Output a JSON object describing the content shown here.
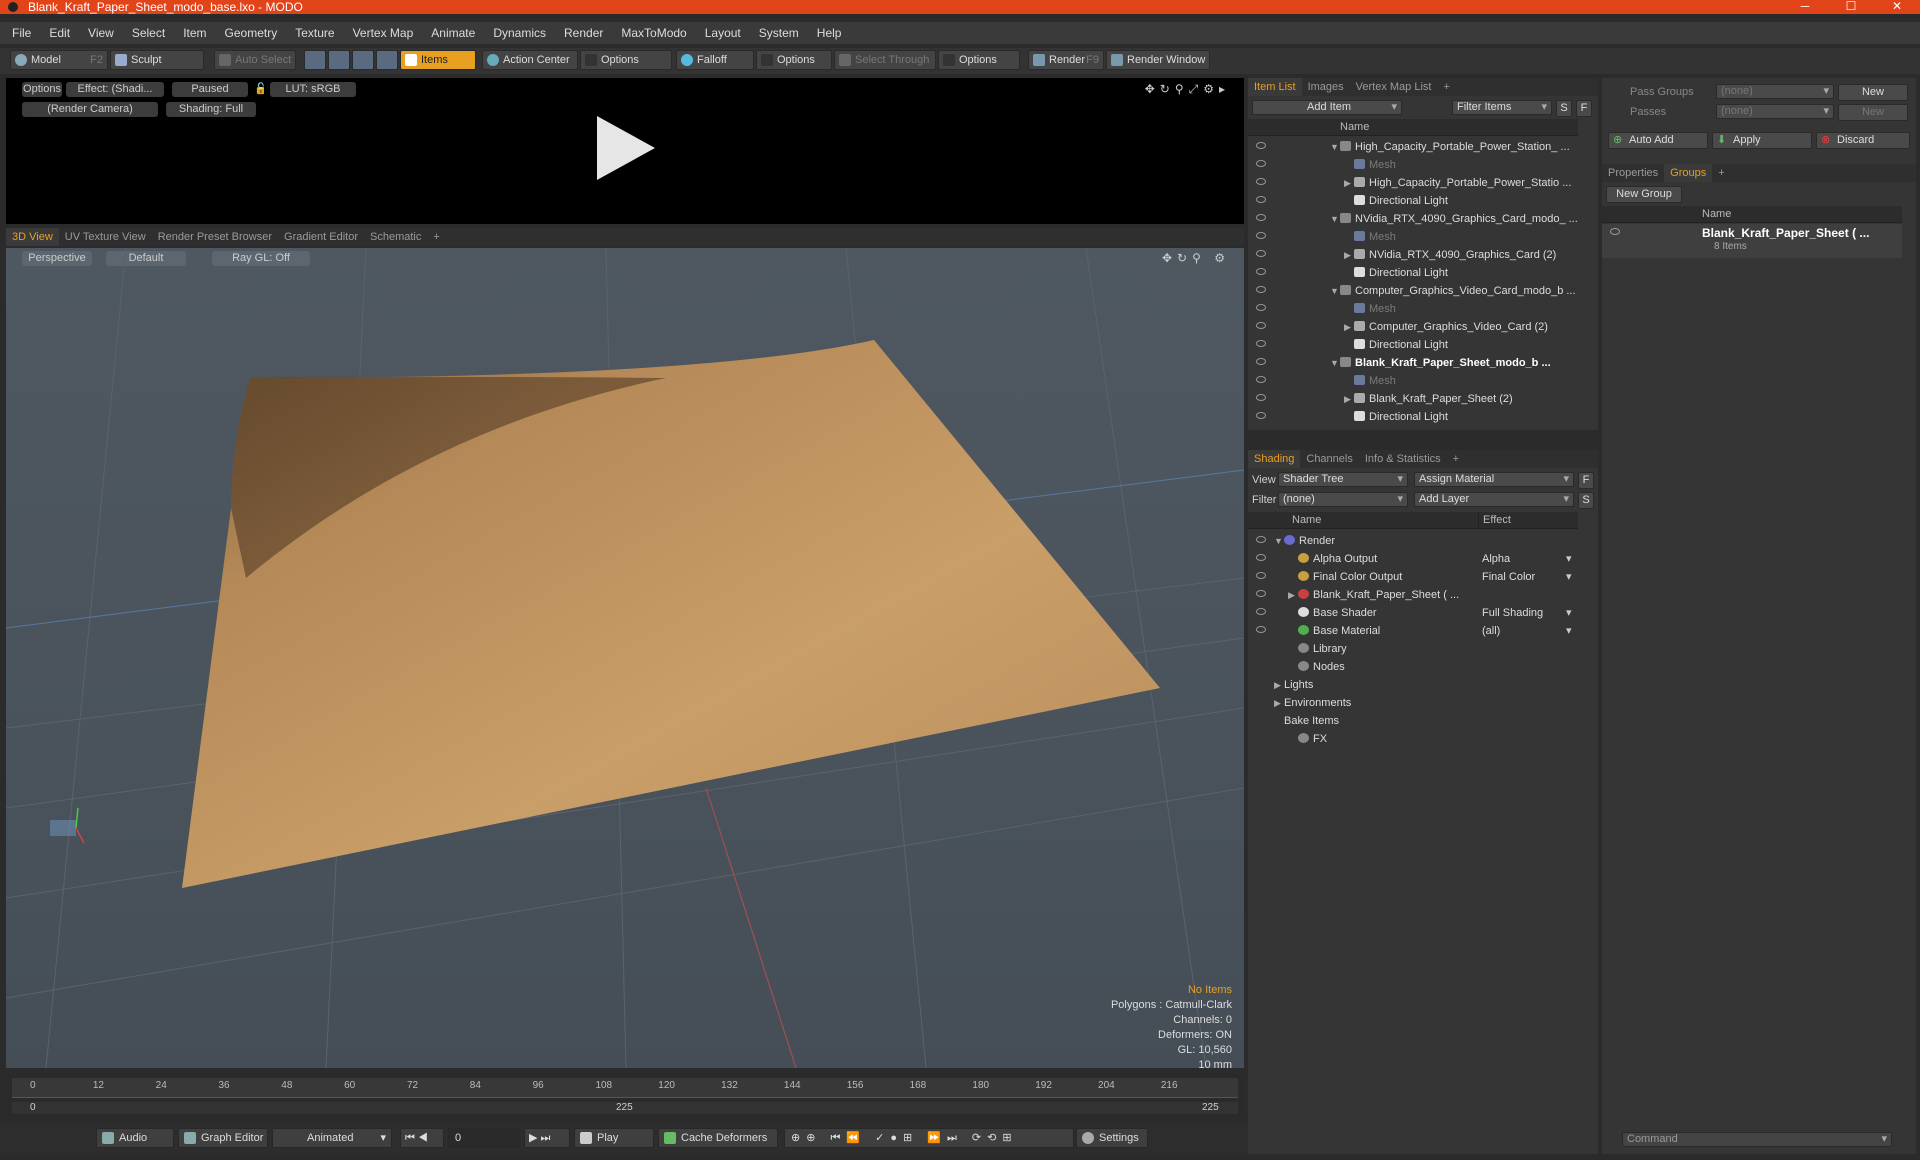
{
  "window": {
    "title": "Blank_Kraft_Paper_Sheet_modo_base.lxo - MODO",
    "minimize": "─",
    "maximize": "☐",
    "close": "✕"
  },
  "menu": [
    "File",
    "Edit",
    "View",
    "Select",
    "Item",
    "Geometry",
    "Texture",
    "Vertex Map",
    "Animate",
    "Dynamics",
    "Render",
    "MaxToModo",
    "Layout",
    "System",
    "Help"
  ],
  "toolbar": {
    "model": "Model",
    "model_key": "F2",
    "sculpt": "Sculpt",
    "auto_select": "Auto Select",
    "items": "Items",
    "action_center": "Action Center",
    "options1": "Options",
    "falloff": "Falloff",
    "options2": "Options",
    "select_through": "Select Through",
    "options3": "Options",
    "render": "Render",
    "render_key": "F9",
    "render_window": "Render Window"
  },
  "render_preview": {
    "options": "Options",
    "effect": "Effect: (Shadi...",
    "paused": "Paused",
    "lut": "LUT: sRGB",
    "camera": "(Render Camera)",
    "shading": "Shading: Full"
  },
  "view_tabs": [
    "3D View",
    "UV Texture View",
    "Render Preset Browser",
    "Gradient Editor",
    "Schematic",
    "+"
  ],
  "viewport": {
    "perspective": "Perspective",
    "default": "Default",
    "raygl": "Ray GL: Off",
    "hud": {
      "items": "No Items",
      "polygons": "Polygons : Catmull-Clark",
      "channels": "Channels: 0",
      "deformers": "Deformers: ON",
      "gl": "GL: 10,560",
      "scale": "10 mm"
    }
  },
  "timeline": {
    "ticks": [
      "0",
      "12",
      "24",
      "36",
      "48",
      "60",
      "72",
      "84",
      "96",
      "108",
      "120",
      "132",
      "144",
      "156",
      "168",
      "180",
      "192",
      "204",
      "216"
    ],
    "range_start": "0",
    "range_mid": "225",
    "range_end": "225"
  },
  "bottombar": {
    "audio": "Audio",
    "graph_editor": "Graph Editor",
    "animated": "Animated",
    "frame": "0",
    "play": "Play",
    "cache_deformers": "Cache Deformers",
    "settings": "Settings"
  },
  "item_list": {
    "tabs": [
      "Item List",
      "Images",
      "Vertex Map List",
      "+"
    ],
    "add_item": "Add Item",
    "filter_items": "Filter Items",
    "s": "S",
    "f": "F",
    "name_header": "Name",
    "rows": [
      {
        "indent": 0,
        "expand": "▼",
        "label": "High_Capacity_Portable_Power_Station_ ...",
        "kind": "scene",
        "style": ""
      },
      {
        "indent": 1,
        "expand": "",
        "label": "Mesh",
        "kind": "mesh",
        "style": "muted"
      },
      {
        "indent": 1,
        "expand": "▶",
        "label": "High_Capacity_Portable_Power_Statio ...",
        "kind": "group",
        "style": ""
      },
      {
        "indent": 1,
        "expand": "",
        "label": "Directional Light",
        "kind": "light",
        "style": ""
      },
      {
        "indent": 0,
        "expand": "▼",
        "label": "NVidia_RTX_4090_Graphics_Card_modo_ ...",
        "kind": "scene",
        "style": ""
      },
      {
        "indent": 1,
        "expand": "",
        "label": "Mesh",
        "kind": "mesh",
        "style": "muted"
      },
      {
        "indent": 1,
        "expand": "▶",
        "label": "NVidia_RTX_4090_Graphics_Card (2)",
        "kind": "group",
        "style": ""
      },
      {
        "indent": 1,
        "expand": "",
        "label": "Directional Light",
        "kind": "light",
        "style": ""
      },
      {
        "indent": 0,
        "expand": "▼",
        "label": "Computer_Graphics_Video_Card_modo_b ...",
        "kind": "scene",
        "style": ""
      },
      {
        "indent": 1,
        "expand": "",
        "label": "Mesh",
        "kind": "mesh",
        "style": "muted"
      },
      {
        "indent": 1,
        "expand": "▶",
        "label": "Computer_Graphics_Video_Card (2)",
        "kind": "group",
        "style": ""
      },
      {
        "indent": 1,
        "expand": "",
        "label": "Directional Light",
        "kind": "light",
        "style": ""
      },
      {
        "indent": 0,
        "expand": "▼",
        "label": "Blank_Kraft_Paper_Sheet_modo_b ...",
        "kind": "scene",
        "style": "bold"
      },
      {
        "indent": 1,
        "expand": "",
        "label": "Mesh",
        "kind": "mesh",
        "style": "muted"
      },
      {
        "indent": 1,
        "expand": "▶",
        "label": "Blank_Kraft_Paper_Sheet (2)",
        "kind": "group",
        "style": ""
      },
      {
        "indent": 1,
        "expand": "",
        "label": "Directional Light",
        "kind": "light",
        "style": ""
      }
    ]
  },
  "shading": {
    "tabs": [
      "Shading",
      "Channels",
      "Info & Statistics",
      "+"
    ],
    "view_label": "View",
    "view_value": "Shader Tree",
    "assign_material": "Assign Material",
    "f": "F",
    "filter_label": "Filter",
    "filter_value": "(none)",
    "add_layer": "Add Layer",
    "s": "S",
    "name_header": "Name",
    "effect_header": "Effect",
    "rows": [
      {
        "indent": 0,
        "expand": "▼",
        "label": "Render",
        "effect": "",
        "icon": "#6a6ad0"
      },
      {
        "indent": 1,
        "expand": "",
        "label": "Alpha Output",
        "effect": "Alpha",
        "icon": "#c8a040"
      },
      {
        "indent": 1,
        "expand": "",
        "label": "Final Color Output",
        "effect": "Final Color",
        "icon": "#c8a040"
      },
      {
        "indent": 1,
        "expand": "▶",
        "label": "Blank_Kraft_Paper_Sheet ( ...",
        "effect": "",
        "icon": "#c84040"
      },
      {
        "indent": 1,
        "expand": "",
        "label": "Base Shader",
        "effect": "Full Shading",
        "icon": "#dddddd"
      },
      {
        "indent": 1,
        "expand": "",
        "label": "Base Material",
        "effect": "(all)",
        "icon": "#50b050"
      },
      {
        "indent": 1,
        "expand": "",
        "label": "Library",
        "effect": "",
        "icon": "#888888"
      },
      {
        "indent": 1,
        "expand": "",
        "label": "Nodes",
        "effect": "",
        "icon": "#888888"
      },
      {
        "indent": 0,
        "expand": "▶",
        "label": "Lights",
        "effect": "",
        "icon": ""
      },
      {
        "indent": 0,
        "expand": "▶",
        "label": "Environments",
        "effect": "",
        "icon": ""
      },
      {
        "indent": 0,
        "expand": "",
        "label": "Bake Items",
        "effect": "",
        "icon": ""
      },
      {
        "indent": 1,
        "expand": "",
        "label": "FX",
        "effect": "",
        "icon": "#888888"
      }
    ]
  },
  "groups": {
    "pass_groups_label": "Pass Groups",
    "pass_groups_value": "(none)",
    "new1": "New",
    "passes_label": "Passes",
    "passes_value": "(none)",
    "new2": "New",
    "auto_add": "Auto Add",
    "apply": "Apply",
    "discard": "Discard",
    "tabs": [
      "Properties",
      "Groups",
      "+"
    ],
    "new_group": "New Group",
    "name_header": "Name",
    "item_name": "Blank_Kraft_Paper_Sheet ( ...",
    "item_count": "8 Items",
    "command_placeholder": "Command"
  },
  "colors": {
    "accent": "#e8a020",
    "title_bar": "#e2441a",
    "paper": "#c79a63"
  }
}
